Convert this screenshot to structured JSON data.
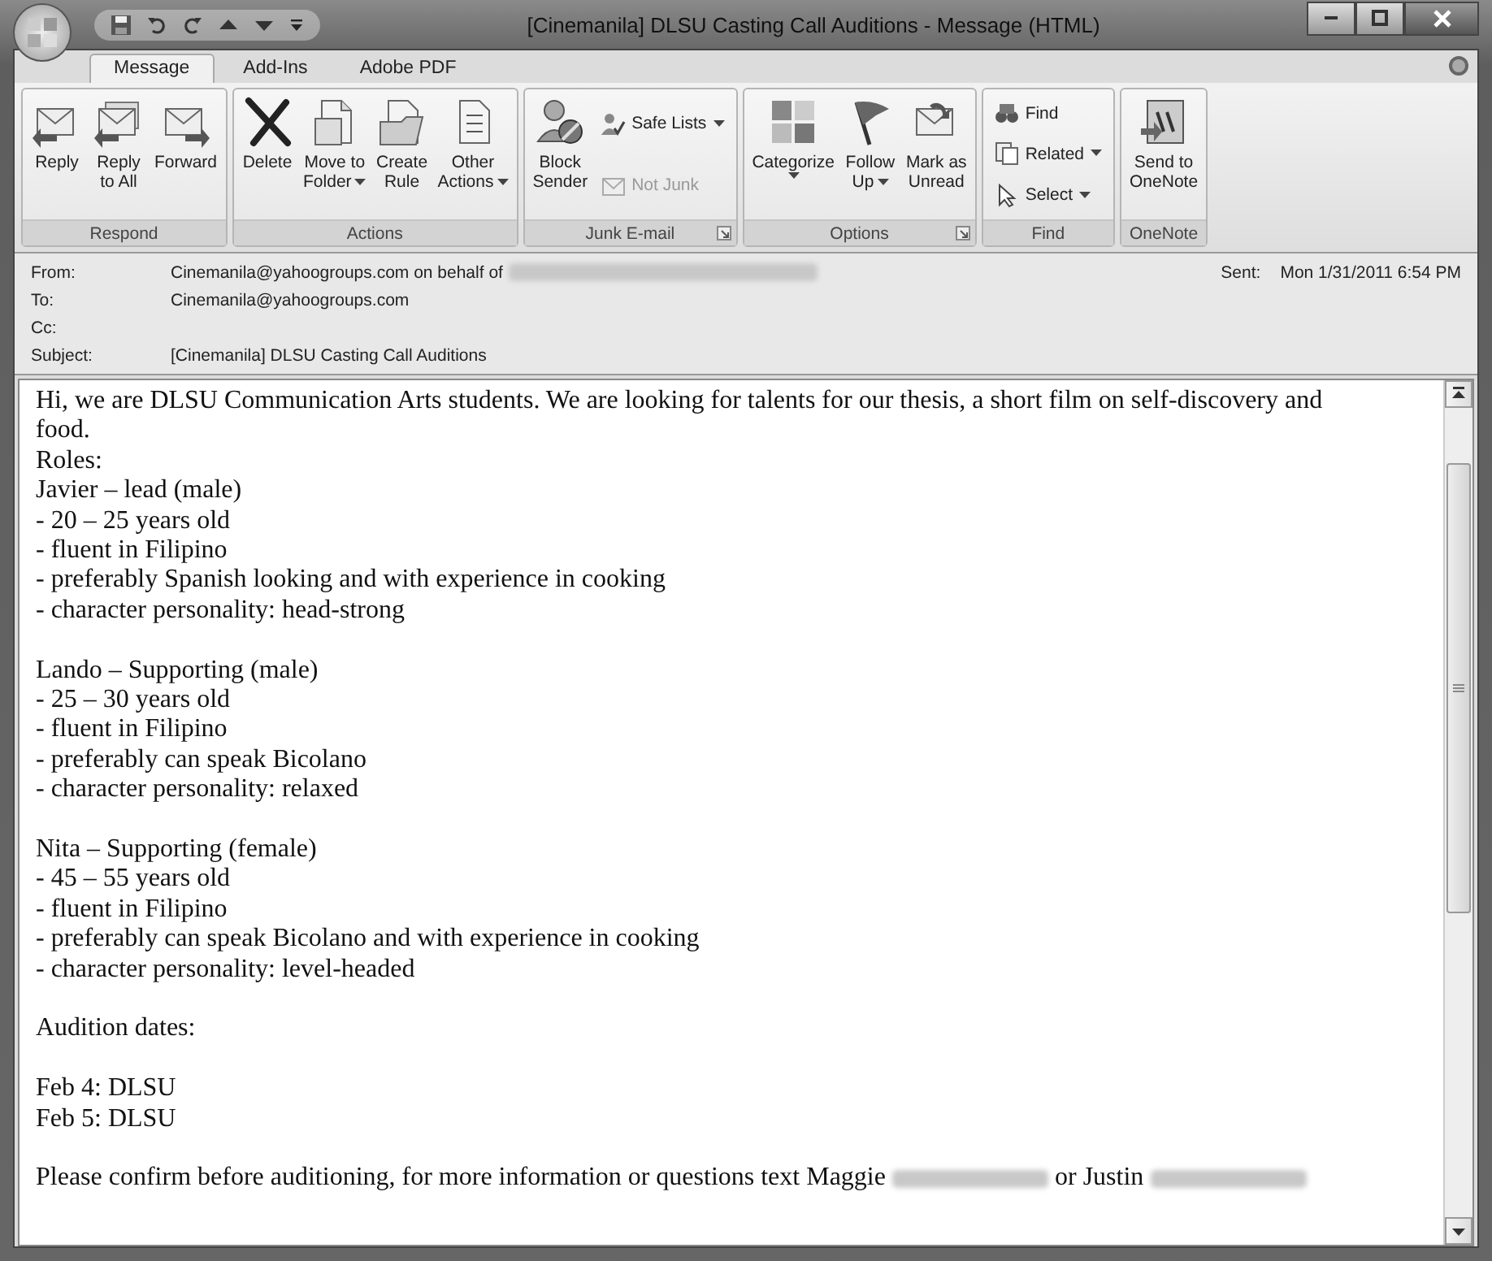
{
  "window": {
    "title": "[Cinemanila] DLSU Casting Call Auditions - Message (HTML)"
  },
  "tabs": [
    {
      "label": "Message",
      "selected": true
    },
    {
      "label": "Add-Ins",
      "selected": false
    },
    {
      "label": "Adobe PDF",
      "selected": false
    }
  ],
  "ribbon_groups": [
    {
      "label": "Respond",
      "launcher": false,
      "buttons": [
        {
          "kind": "large",
          "lines": [
            "Reply"
          ],
          "dropdown": false
        },
        {
          "kind": "large",
          "lines": [
            "Reply",
            "to All"
          ],
          "dropdown": false
        },
        {
          "kind": "large",
          "lines": [
            "Forward"
          ],
          "dropdown": false
        }
      ]
    },
    {
      "label": "Actions",
      "launcher": false,
      "buttons": [
        {
          "kind": "large",
          "lines": [
            "Delete"
          ],
          "dropdown": false
        },
        {
          "kind": "large",
          "lines": [
            "Move to",
            "Folder"
          ],
          "dropdown": true
        },
        {
          "kind": "large",
          "lines": [
            "Create",
            "Rule"
          ],
          "dropdown": false
        },
        {
          "kind": "large",
          "lines": [
            "Other",
            "Actions"
          ],
          "dropdown": true
        }
      ]
    },
    {
      "label": "Junk E-mail",
      "launcher": true,
      "buttons": [
        {
          "kind": "large",
          "lines": [
            "Block",
            "Sender"
          ],
          "dropdown": false
        },
        {
          "kind": "stack",
          "items": [
            {
              "label": "Safe Lists",
              "dropdown": true,
              "disabled": false
            },
            {
              "label": "Not Junk",
              "dropdown": false,
              "disabled": true
            }
          ]
        }
      ]
    },
    {
      "label": "Options",
      "launcher": true,
      "buttons": [
        {
          "kind": "large",
          "lines": [
            "Categorize"
          ],
          "dropdown": true
        },
        {
          "kind": "large",
          "lines": [
            "Follow",
            "Up"
          ],
          "dropdown": true
        },
        {
          "kind": "large",
          "lines": [
            "Mark as",
            "Unread"
          ],
          "dropdown": false
        }
      ]
    },
    {
      "label": "Find",
      "launcher": false,
      "buttons": [
        {
          "kind": "stack",
          "items": [
            {
              "label": "Find",
              "dropdown": false,
              "disabled": false
            },
            {
              "label": "Related",
              "dropdown": true,
              "disabled": false
            },
            {
              "label": "Select",
              "dropdown": true,
              "disabled": false
            }
          ]
        }
      ]
    },
    {
      "label": "OneNote",
      "launcher": false,
      "buttons": [
        {
          "kind": "large",
          "lines": [
            "Send to",
            "OneNote"
          ],
          "dropdown": false
        }
      ]
    }
  ],
  "header": {
    "from_label": "From:",
    "from": "Cinemanila@yahoogroups.com on behalf of",
    "to_label": "To:",
    "to": "Cinemanila@yahoogroups.com",
    "cc_label": "Cc:",
    "subject_label": "Subject:",
    "subject": "[Cinemanila] DLSU Casting Call Auditions",
    "sent_label": "Sent:",
    "sent": "Mon 1/31/2011 6:54 PM"
  },
  "body": [
    [
      "Hi, we are DLSU Communication Arts students. We are looking for talents for our thesis, a short film on self-discovery and food.",
      "Roles:",
      "Javier – lead (male)",
      "- 20 – 25 years old",
      "- fluent in Filipino",
      "- preferably Spanish looking and with experience in cooking",
      "- character personality: head-strong"
    ],
    [
      "Lando – Supporting (male)",
      "- 25 – 30 years old",
      "- fluent in Filipino",
      "- preferably can speak Bicolano",
      "- character personality: relaxed"
    ],
    [
      "Nita – Supporting (female)",
      "- 45 – 55 years old",
      "- fluent in Filipino",
      "- preferably can speak Bicolano and with experience in cooking",
      "- character personality: level-headed"
    ],
    [
      "Audition dates:"
    ],
    [
      "Feb 4: DLSU",
      "Feb 5: DLSU"
    ]
  ],
  "closing": [
    "Please confirm before auditioning, for more information or questions text Maggie",
    "or Justin"
  ]
}
